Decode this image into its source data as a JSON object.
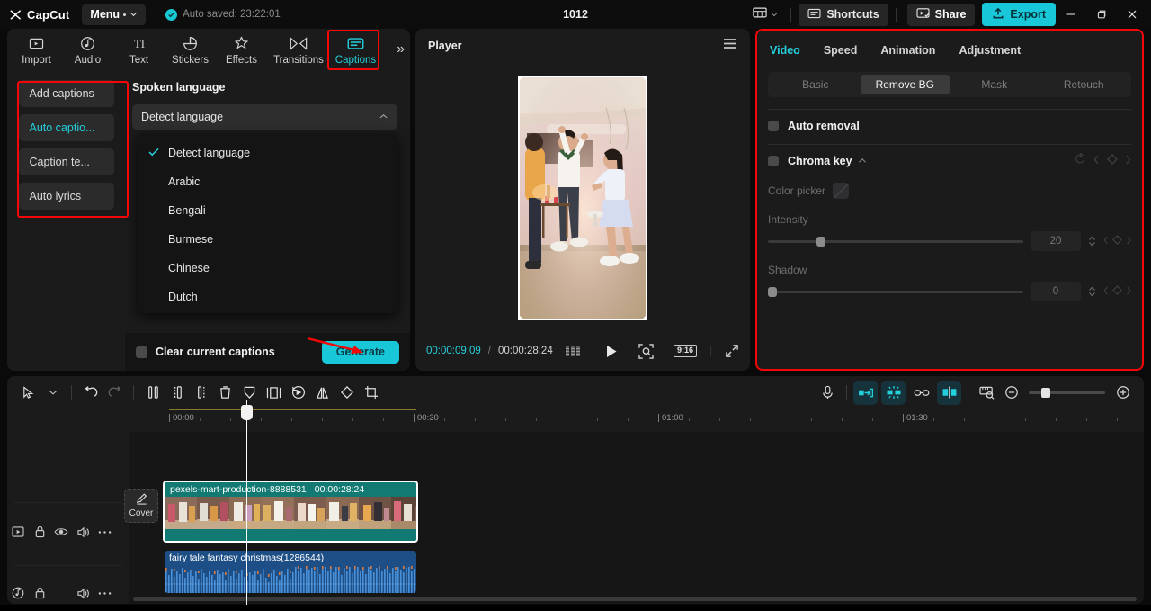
{
  "titlebar": {
    "brand": "CapCut",
    "menu_label": "Menu",
    "autosave_text": "Auto saved: 23:22:01",
    "project_title": "1012",
    "shortcuts_label": "Shortcuts",
    "share_label": "Share",
    "export_label": "Export",
    "minimize": "—",
    "maximize": "❐",
    "close": "✕",
    "accent": "#18c8d8"
  },
  "left_panel": {
    "nav": [
      {
        "label": "Import",
        "icon": "import-icon",
        "active": false
      },
      {
        "label": "Audio",
        "icon": "audio-icon",
        "active": false
      },
      {
        "label": "Text",
        "icon": "text-icon",
        "active": false
      },
      {
        "label": "Stickers",
        "icon": "stickers-icon",
        "active": false
      },
      {
        "label": "Effects",
        "icon": "effects-icon",
        "active": false
      },
      {
        "label": "Transitions",
        "icon": "transitions-icon",
        "active": false
      },
      {
        "label": "Captions",
        "icon": "captions-icon",
        "active": true
      }
    ],
    "expand_icon": "»",
    "side_items": [
      {
        "label": "Add captions",
        "active": false
      },
      {
        "label": "Auto captio...",
        "active": true
      },
      {
        "label": "Caption te...",
        "active": false
      },
      {
        "label": "Auto lyrics",
        "active": false
      }
    ],
    "section_label": "Spoken language",
    "select_value": "Detect language",
    "select_caret": "chevron-up-icon",
    "dropdown_options": [
      {
        "label": "Detect language",
        "checked": true
      },
      {
        "label": "Arabic",
        "checked": false
      },
      {
        "label": "Bengali",
        "checked": false
      },
      {
        "label": "Burmese",
        "checked": false
      },
      {
        "label": "Chinese",
        "checked": false
      },
      {
        "label": "Dutch",
        "checked": false
      }
    ],
    "checkbox_label": "Clear current captions",
    "generate_label": "Generate"
  },
  "player": {
    "title": "Player",
    "menu_icon": "hamburger-icon",
    "current_time": "00:00:09:09",
    "time_separator": "/",
    "total_time": "00:00:28:24",
    "ratio_label": "9:16",
    "play_icon": "play-icon",
    "quality_icon": "quality-icon",
    "zoom_fit_icon": "zoom-fit-icon",
    "fullscreen_icon": "fullscreen-icon"
  },
  "right_panel": {
    "tabs": [
      {
        "label": "Video",
        "active": true
      },
      {
        "label": "Speed",
        "active": false
      },
      {
        "label": "Animation",
        "active": false
      },
      {
        "label": "Adjustment",
        "active": false
      }
    ],
    "segments": [
      {
        "label": "Basic",
        "active": false
      },
      {
        "label": "Remove BG",
        "active": true
      },
      {
        "label": "Mask",
        "active": false
      },
      {
        "label": "Retouch",
        "active": false
      }
    ],
    "auto_removal_label": "Auto removal",
    "chroma_key_label": "Chroma key",
    "color_picker_label": "Color picker",
    "intensity_label": "Intensity",
    "intensity_value": "20",
    "shadow_label": "Shadow",
    "shadow_value": "0",
    "highlight_color": "#f40707"
  },
  "timeline": {
    "toolbar_left": [
      {
        "name": "select-tool-icon",
        "state": "normal"
      },
      {
        "name": "chevron-down-icon",
        "state": "normal"
      },
      {
        "name": "undo-icon",
        "state": "normal"
      },
      {
        "name": "redo-icon",
        "state": "disabled"
      },
      {
        "name": "split-left-icon",
        "state": "normal"
      },
      {
        "name": "split-right-icon",
        "state": "normal"
      },
      {
        "name": "split-icon",
        "state": "normal"
      },
      {
        "name": "delete-icon",
        "state": "normal"
      },
      {
        "name": "freeze-icon",
        "state": "normal"
      },
      {
        "name": "crop-frame-icon",
        "state": "normal"
      },
      {
        "name": "reverse-icon",
        "state": "normal"
      },
      {
        "name": "mirror-icon",
        "state": "normal"
      },
      {
        "name": "rotate-icon",
        "state": "normal"
      },
      {
        "name": "crop-icon",
        "state": "normal"
      }
    ],
    "toolbar_right": [
      {
        "name": "microphone-icon",
        "state": "normal"
      },
      {
        "name": "auto-cut-icon",
        "state": "active"
      },
      {
        "name": "smart-split-icon",
        "state": "active"
      },
      {
        "name": "link-icon",
        "state": "normal"
      },
      {
        "name": "snap-icon",
        "state": "active"
      },
      {
        "name": "ruler-icon",
        "state": "normal"
      },
      {
        "name": "zoom-out-icon",
        "state": "normal"
      },
      {
        "name": "zoom-in-icon",
        "state": "normal"
      }
    ],
    "ruler_labels": [
      "00:00",
      "00:30",
      "01:00",
      "01:30"
    ],
    "video_track_controls": [
      "track-type-icon",
      "lock-icon",
      "eye-icon",
      "volume-icon",
      "more-icon"
    ],
    "audio_track_controls": [
      "audio-type-icon",
      "lock-icon",
      "volume-icon",
      "more-icon"
    ],
    "cover_label": "Cover",
    "video_clip": {
      "name": "pexels-mart-production-8888531",
      "duration": "00:00:28:24",
      "color": "#127a72"
    },
    "audio_clip": {
      "name": "fairy tale fantasy christmas(1286544)",
      "color": "#1d4f86"
    }
  }
}
